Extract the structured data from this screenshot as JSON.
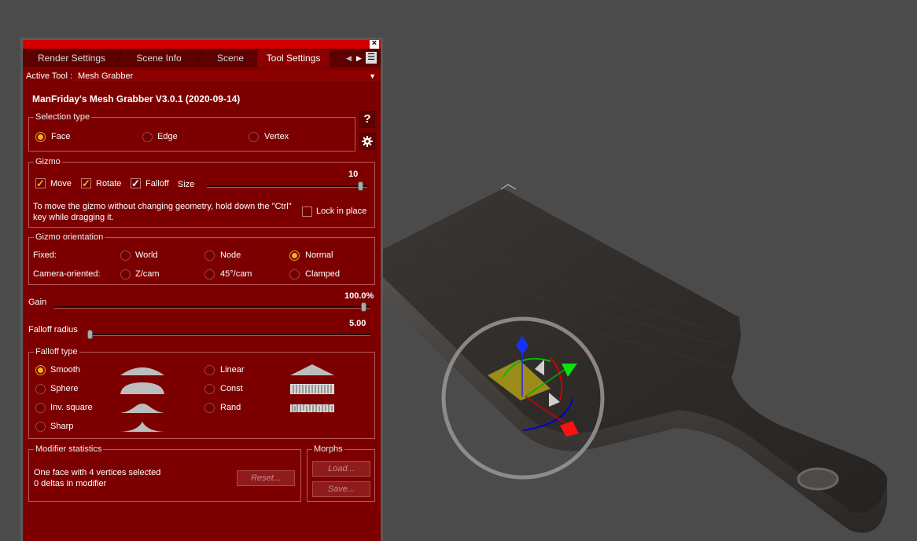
{
  "tabs": [
    {
      "label": "Render Settings"
    },
    {
      "label": "Scene Info"
    },
    {
      "label": "Scene"
    },
    {
      "label": "Tool Settings"
    }
  ],
  "active_tool": {
    "label": "Active Tool :",
    "value": "Mesh Grabber"
  },
  "plugin_title": "ManFriday's Mesh Grabber V3.0.1 (2020-09-14)",
  "selection_type": {
    "title": "Selection type",
    "options": [
      "Face",
      "Edge",
      "Vertex"
    ],
    "selected": "Face"
  },
  "side_buttons": {
    "help": "?",
    "settings_icon": "gear-icon"
  },
  "gizmo": {
    "title": "Gizmo",
    "move_label": "Move",
    "rotate_label": "Rotate",
    "falloff_label": "Falloff",
    "size_label": "Size",
    "size_value": "10",
    "size_fraction": 1.0,
    "hint": "To move the gizmo without changing geometry, hold down the \"Ctrl\" key while dragging it.",
    "lock_label": "Lock in place"
  },
  "gizmo_orientation": {
    "title": "Gizmo orientation",
    "fixed_label": "Fixed:",
    "camera_label": "Camera-oriented:",
    "fixed_options": [
      "World",
      "Node",
      "Normal"
    ],
    "camera_options": [
      "Z/cam",
      "45°/cam",
      "Clamped"
    ],
    "selected": "Normal"
  },
  "gain": {
    "label": "Gain",
    "value": "100.0%",
    "fraction": 1.0
  },
  "falloff_radius": {
    "label": "Falloff radius",
    "value": "5.00",
    "fraction": 0.0
  },
  "falloff_type": {
    "title": "Falloff type",
    "options": [
      "Smooth",
      "Sphere",
      "Inv. square",
      "Sharp",
      "Linear",
      "Const",
      "Rand"
    ],
    "selected": "Smooth"
  },
  "modifier_stats": {
    "title": "Modifier statistics",
    "line1": "One face with 4 vertices selected",
    "line2": "0 deltas in modifier",
    "reset_label": "Reset..."
  },
  "morphs": {
    "title": "Morphs",
    "load_label": "Load...",
    "save_label": "Save..."
  },
  "colors": {
    "panel": "#7d0000",
    "accent": "#f5b020",
    "topbar": "#d40000",
    "viewport": "#4b4b4b"
  }
}
